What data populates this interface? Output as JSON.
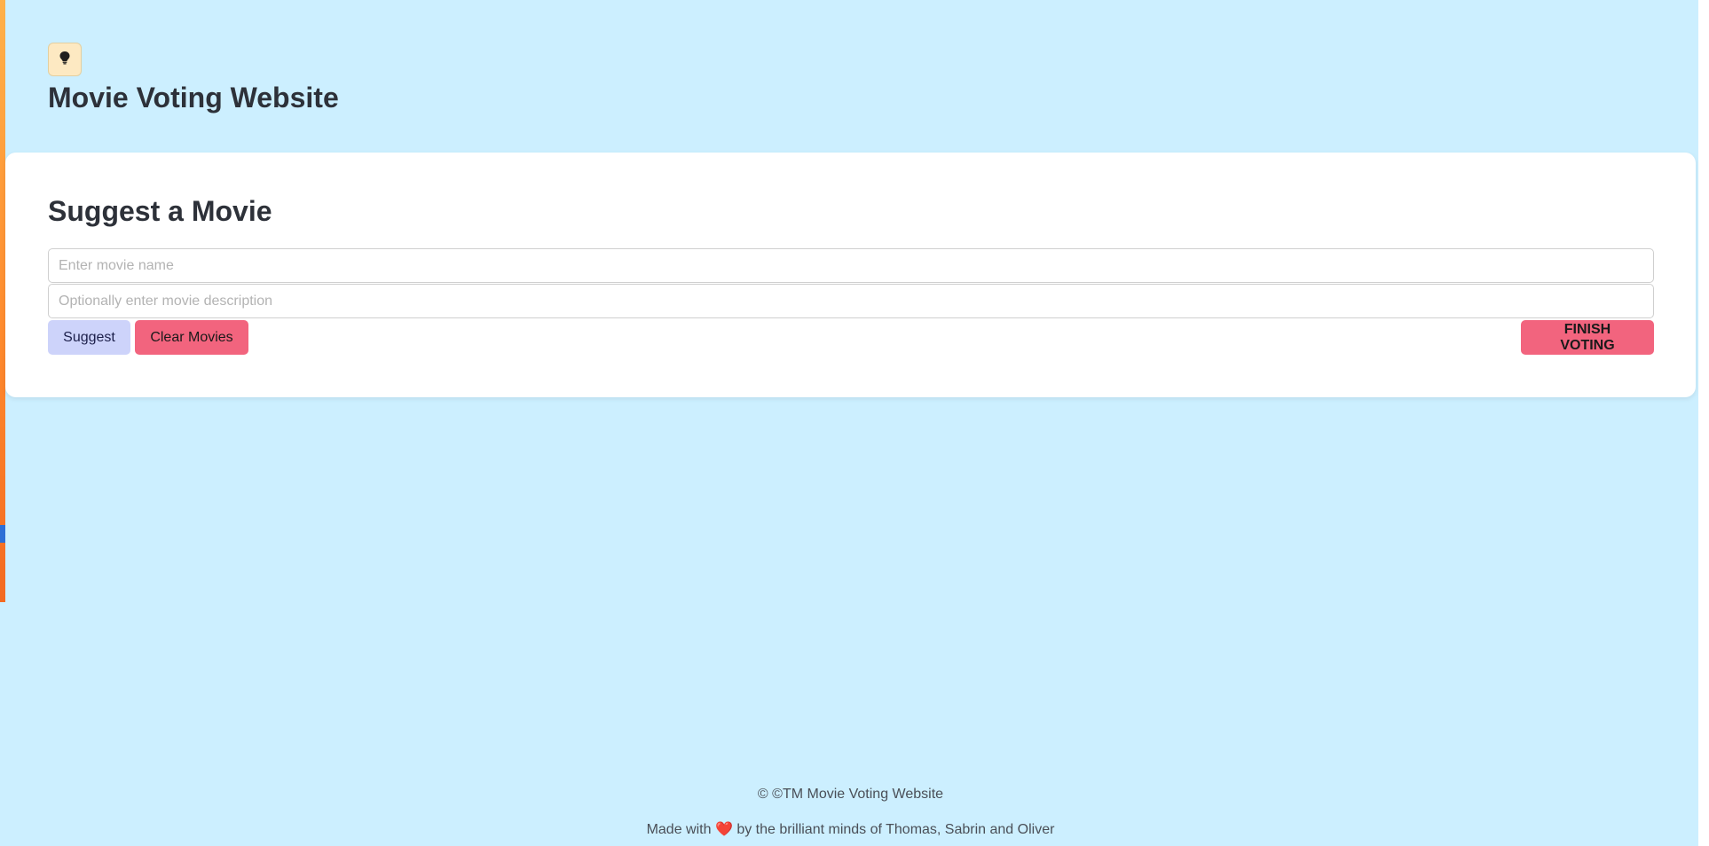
{
  "header": {
    "logo_icon": "lightbulb-icon",
    "title": "Movie Voting Website"
  },
  "suggest_card": {
    "title": "Suggest a Movie",
    "movie_name_placeholder": "Enter movie name",
    "movie_name_value": "",
    "movie_description_placeholder": "Optionally enter movie description",
    "movie_description_value": "",
    "suggest_label": "Suggest",
    "clear_label": "Clear Movies",
    "finish_label": "FINISH VOTING"
  },
  "footer": {
    "copyright": "© ©TM Movie Voting Website",
    "made_with_prefix": "Made with",
    "heart_icon": "heart-icon",
    "heart_glyph": "❤️",
    "made_with_suffix": "by the brilliant minds of Thomas, Sabrin and Oliver"
  },
  "colors": {
    "background": "#ccefff",
    "card": "#ffffff",
    "suggest_button": "#cdd3fa",
    "danger_button": "#f2647e",
    "logo_badge": "#fde9c2"
  }
}
